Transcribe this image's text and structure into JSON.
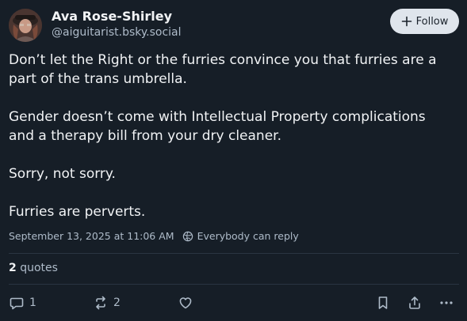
{
  "post": {
    "author": {
      "display_name": "Ava Rose-Shirley",
      "handle": "@aiguitarist.bsky.social",
      "avatar_icon": "avatar-photo"
    },
    "follow_label": "Follow",
    "paragraphs": [
      "Don’t let the Right or the furries convince you that furries are a part of the trans umbrella.",
      "Gender doesn’t come with Intellectual Property complications and a therapy bill from your dry cleaner.",
      "Sorry, not sorry.",
      "Furries are perverts."
    ],
    "timestamp": "September 13, 2025 at 11:06 AM",
    "reply_setting": "Everybody can reply",
    "quotes": {
      "count": "2",
      "label": "quotes"
    },
    "actions": {
      "reply_count": "1",
      "repost_count": "2"
    }
  },
  "colors": {
    "background": "#161e27",
    "text": "#f1f3f5",
    "muted": "#aebbc9",
    "follow_button_bg": "#dfe5ec"
  }
}
